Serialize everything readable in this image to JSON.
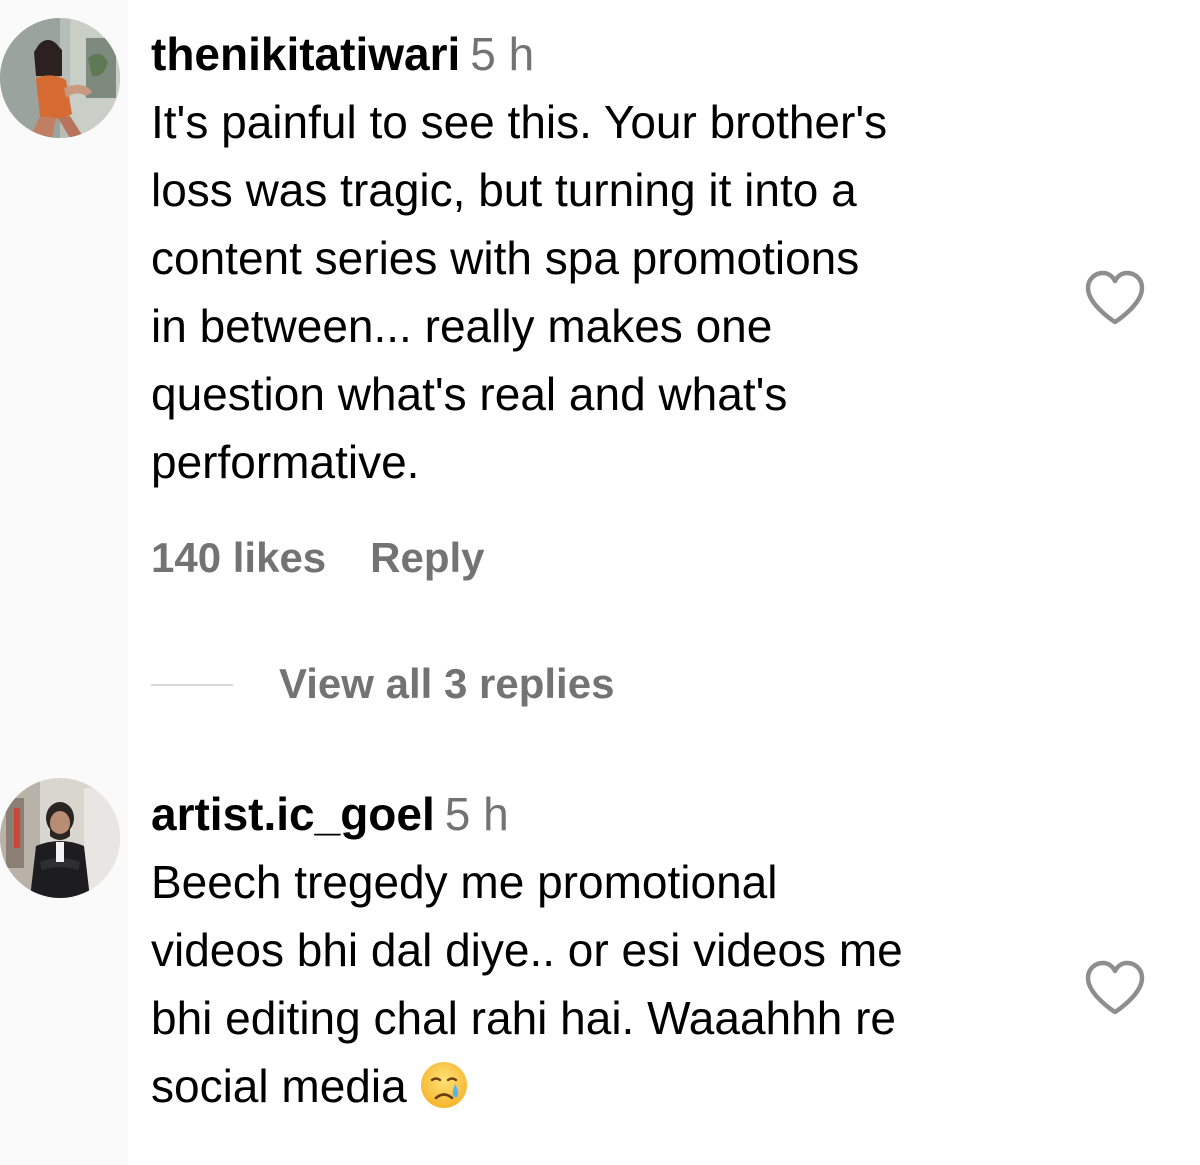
{
  "comments": [
    {
      "username": "thenikitatiwari",
      "time": "5 h",
      "text_lines": [
        "It's painful to see this. Your brother's",
        "loss was tragic, but turning it into a",
        "content series with spa promotions",
        "in between... really makes one",
        "question what's real and what's",
        "performative."
      ],
      "likes": "140 likes",
      "reply_label": "Reply",
      "view_replies": "View all 3 replies"
    },
    {
      "username": "artist.ic_goel",
      "time": "5 h",
      "text_lines": [
        "Beech tregedy me promotional",
        "videos bhi dal diye.. or esi videos me",
        "bhi editing chal rahi hai. Waaahhh re",
        "social media"
      ],
      "emoji": "crying-face-emoji"
    }
  ],
  "icons": {
    "like": "heart-outline-icon"
  },
  "colors": {
    "text": "#000000",
    "secondary": "#737373",
    "divider": "#dbdbdb",
    "heart_stroke": "#8e8e8e",
    "left_strip": "#fafafa"
  }
}
